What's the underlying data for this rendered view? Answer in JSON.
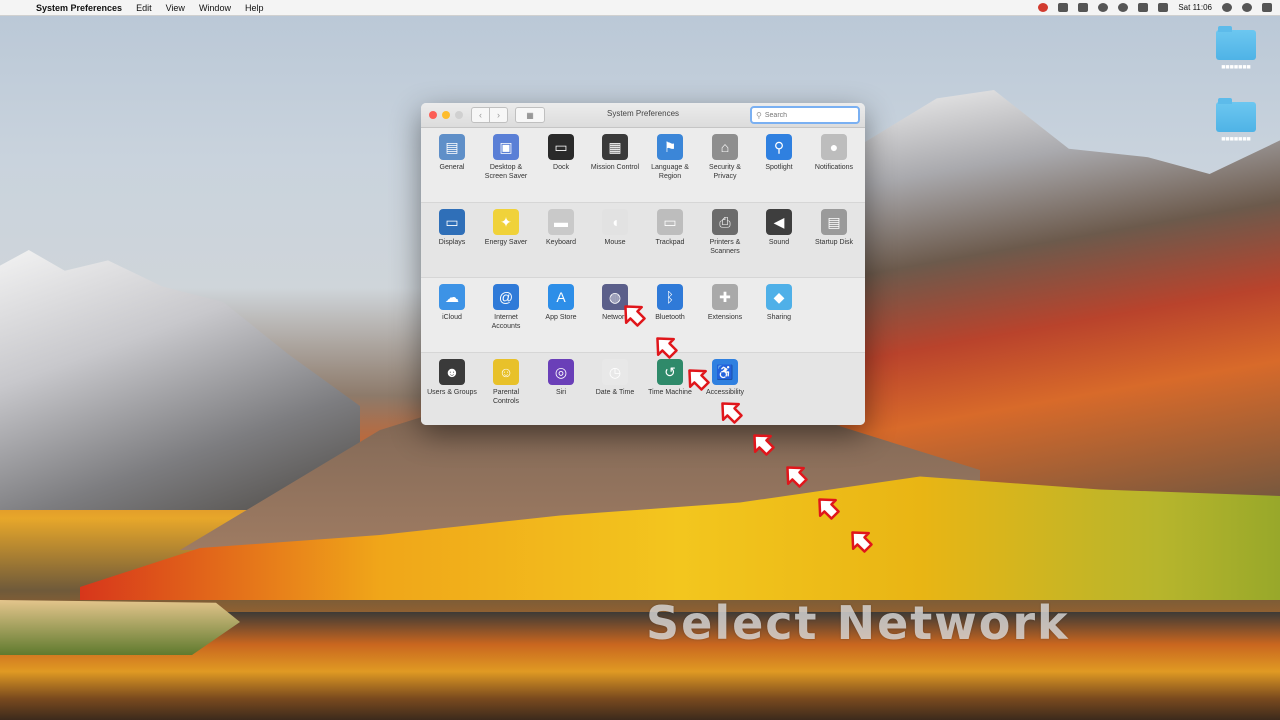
{
  "menubar": {
    "apple_icon": "apple-icon",
    "app_name": "System Preferences",
    "items": [
      "Edit",
      "View",
      "Window",
      "Help"
    ],
    "clock": "Sat 11:06"
  },
  "desktop": {
    "folders": [
      {
        "label": "■■■■■■■"
      },
      {
        "label": "■■■■■■■"
      }
    ]
  },
  "window": {
    "title": "System Preferences",
    "search_placeholder": "Search",
    "rows": [
      [
        {
          "name": "pane-general",
          "icon": "general-icon",
          "label": "General",
          "color": "#5f8fc8",
          "glyph": "▤"
        },
        {
          "name": "pane-desktop-screen-saver",
          "icon": "desktop-icon",
          "label": "Desktop & Screen Saver",
          "color": "#5a7fd6",
          "glyph": "▣"
        },
        {
          "name": "pane-dock",
          "icon": "dock-icon",
          "label": "Dock",
          "color": "#2a2a2a",
          "glyph": "▭"
        },
        {
          "name": "pane-mission-control",
          "icon": "mission-control-icon",
          "label": "Mission Control",
          "color": "#3a3a3a",
          "glyph": "▦"
        },
        {
          "name": "pane-language-region",
          "icon": "flag-icon",
          "label": "Language & Region",
          "color": "#3b86d8",
          "glyph": "⚑"
        },
        {
          "name": "pane-security-privacy",
          "icon": "house-icon",
          "label": "Security & Privacy",
          "color": "#8e8e8e",
          "glyph": "⌂"
        },
        {
          "name": "pane-spotlight",
          "icon": "spotlight-icon",
          "label": "Spotlight",
          "color": "#2f80e0",
          "glyph": "⚲"
        },
        {
          "name": "pane-notifications",
          "icon": "notifications-icon",
          "label": "Notifications",
          "color": "#bdbdbd",
          "glyph": "●"
        }
      ],
      [
        {
          "name": "pane-displays",
          "icon": "display-icon",
          "label": "Displays",
          "color": "#2f6fb8",
          "glyph": "▭"
        },
        {
          "name": "pane-energy-saver",
          "icon": "bulb-icon",
          "label": "Energy Saver",
          "color": "#f0d23a",
          "glyph": "✦"
        },
        {
          "name": "pane-keyboard",
          "icon": "keyboard-icon",
          "label": "Keyboard",
          "color": "#c9c9c9",
          "glyph": "▬"
        },
        {
          "name": "pane-mouse",
          "icon": "mouse-icon",
          "label": "Mouse",
          "color": "#e2e2e2",
          "glyph": "◖"
        },
        {
          "name": "pane-trackpad",
          "icon": "trackpad-icon",
          "label": "Trackpad",
          "color": "#bdbdbd",
          "glyph": "▭"
        },
        {
          "name": "pane-printers-scanners",
          "icon": "printer-icon",
          "label": "Printers & Scanners",
          "color": "#6b6b6b",
          "glyph": "⎙"
        },
        {
          "name": "pane-sound",
          "icon": "speaker-icon",
          "label": "Sound",
          "color": "#3e3e3e",
          "glyph": "◀"
        },
        {
          "name": "pane-startup-disk",
          "icon": "disk-icon",
          "label": "Startup Disk",
          "color": "#9a9a9a",
          "glyph": "▤"
        }
      ],
      [
        {
          "name": "pane-icloud",
          "icon": "cloud-icon",
          "label": "iCloud",
          "color": "#3d93e6",
          "glyph": "☁"
        },
        {
          "name": "pane-internet-accounts",
          "icon": "at-icon",
          "label": "Internet Accounts",
          "color": "#2f7ad8",
          "glyph": "@"
        },
        {
          "name": "pane-app-store",
          "icon": "app-store-icon",
          "label": "App Store",
          "color": "#2d8ee8",
          "glyph": "A"
        },
        {
          "name": "pane-network",
          "icon": "globe-icon",
          "label": "Network",
          "color": "#5b5f8a",
          "glyph": "◍"
        },
        {
          "name": "pane-bluetooth",
          "icon": "bluetooth-icon",
          "label": "Bluetooth",
          "color": "#2f7ad8",
          "glyph": "ᛒ"
        },
        {
          "name": "pane-extensions",
          "icon": "puzzle-icon",
          "label": "Extensions",
          "color": "#a9a9a9",
          "glyph": "✚"
        },
        {
          "name": "pane-sharing",
          "icon": "sharing-icon",
          "label": "Sharing",
          "color": "#4fb0e8",
          "glyph": "◆"
        }
      ],
      [
        {
          "name": "pane-users-groups",
          "icon": "users-icon",
          "label": "Users & Groups",
          "color": "#3a3a3a",
          "glyph": "☻"
        },
        {
          "name": "pane-parental-controls",
          "icon": "parental-icon",
          "label": "Parental Controls",
          "color": "#e8c12a",
          "glyph": "☺"
        },
        {
          "name": "pane-siri",
          "icon": "siri-icon",
          "label": "Siri",
          "color": "#6a3fb8",
          "glyph": "◎"
        },
        {
          "name": "pane-date-time",
          "icon": "clock-icon",
          "label": "Date & Time",
          "color": "#e8e8e8",
          "glyph": "◷"
        },
        {
          "name": "pane-time-machine",
          "icon": "time-machine-icon",
          "label": "Time Machine",
          "color": "#2f8a6a",
          "glyph": "↺"
        },
        {
          "name": "pane-accessibility",
          "icon": "accessibility-icon",
          "label": "Accessibility",
          "color": "#2f80e0",
          "glyph": "♿"
        }
      ]
    ]
  },
  "overlay": {
    "caption": "Select Network",
    "arrow_color": "#e0161b"
  }
}
